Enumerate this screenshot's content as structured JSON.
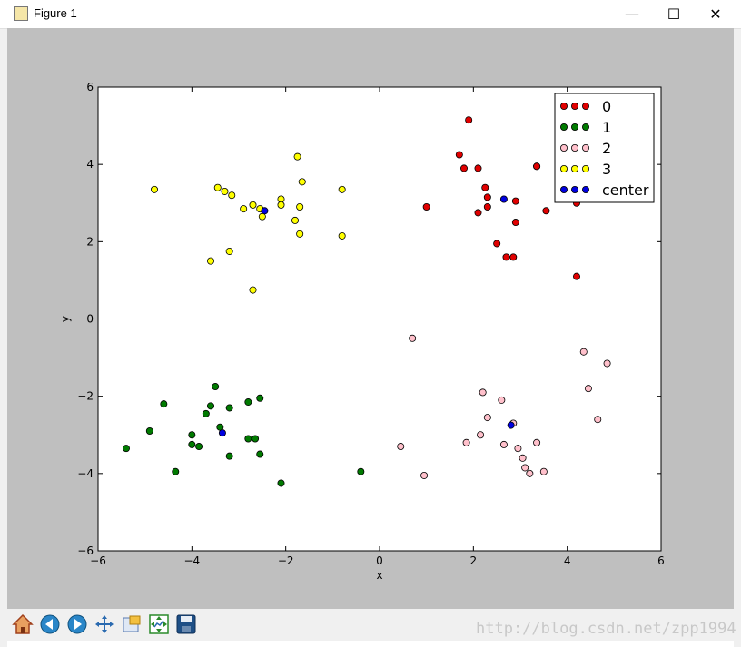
{
  "window": {
    "title": "Figure 1",
    "controls": {
      "minimize": "—",
      "maximize": "☐",
      "close": "✕"
    }
  },
  "toolbar": {
    "tools": [
      {
        "name": "home-icon"
      },
      {
        "name": "back-icon"
      },
      {
        "name": "forward-icon"
      },
      {
        "name": "pan-icon"
      },
      {
        "name": "zoom-icon"
      },
      {
        "name": "subplots-icon"
      },
      {
        "name": "save-icon"
      }
    ]
  },
  "watermark": "http://blog.csdn.net/zpp1994",
  "colors": {
    "c0": "#e00000",
    "c1": "#007a00",
    "c2": "#ffc0cb",
    "c3": "#ffff00",
    "center": "#0000e0",
    "figure_bg": "#bfbfbf"
  },
  "chart_data": {
    "type": "scatter",
    "xlabel": "x",
    "ylabel": "y",
    "xlim": [
      -6,
      6
    ],
    "ylim": [
      -6,
      6
    ],
    "xticks": [
      "−6",
      "−4",
      "−2",
      "0",
      "2",
      "4",
      "6"
    ],
    "yticks": [
      "6",
      "4",
      "2",
      "0",
      "−2",
      "−4",
      "−6"
    ],
    "grid": false,
    "legend_position": "top-right",
    "series": [
      {
        "name": "0",
        "color": "#e00000",
        "x": [
          1.9,
          1.7,
          1.8,
          2.1,
          3.35,
          2.25,
          2.3,
          2.9,
          4.2,
          1.0,
          2.3,
          2.1,
          3.55,
          2.9,
          2.5,
          2.7,
          2.85,
          4.2,
          3.35,
          4.35
        ],
        "y": [
          5.15,
          4.25,
          3.9,
          3.9,
          3.95,
          3.4,
          3.15,
          3.05,
          3.0,
          2.9,
          2.9,
          2.75,
          2.8,
          2.5,
          1.95,
          1.6,
          1.6,
          1.1,
          3.95,
          5.15
        ]
      },
      {
        "name": "1",
        "color": "#007a00",
        "x": [
          -4.6,
          -3.5,
          -3.6,
          -3.7,
          -3.2,
          -2.8,
          -2.55,
          -3.4,
          -4.9,
          -4.0,
          -4.0,
          -3.85,
          -2.8,
          -2.65,
          -5.4,
          -3.2,
          -2.55,
          -4.35,
          -2.1,
          -0.4
        ],
        "y": [
          -2.2,
          -1.75,
          -2.25,
          -2.45,
          -2.3,
          -2.15,
          -2.05,
          -2.8,
          -2.9,
          -3.0,
          -3.25,
          -3.3,
          -3.1,
          -3.1,
          -3.35,
          -3.55,
          -3.5,
          -3.95,
          -4.25,
          -3.95
        ]
      },
      {
        "name": "2",
        "color": "#ffc0cb",
        "x": [
          0.7,
          4.35,
          4.85,
          4.45,
          2.2,
          2.6,
          2.3,
          4.65,
          2.85,
          2.15,
          1.85,
          2.65,
          3.35,
          2.95,
          3.05,
          0.45,
          3.1,
          3.5,
          3.2,
          0.95
        ],
        "y": [
          -0.5,
          -0.85,
          -1.15,
          -1.8,
          -1.9,
          -2.1,
          -2.55,
          -2.6,
          -2.7,
          -3.0,
          -3.2,
          -3.25,
          -3.2,
          -3.35,
          -3.6,
          -3.3,
          -3.85,
          -3.95,
          -4.0,
          -4.05
        ]
      },
      {
        "name": "3",
        "color": "#ffff00",
        "x": [
          -1.75,
          -1.65,
          -4.8,
          -3.45,
          -3.3,
          -3.15,
          -2.1,
          -2.1,
          -2.7,
          -2.55,
          -2.9,
          -1.7,
          -2.5,
          -1.8,
          -1.7,
          -0.8,
          -0.8,
          -3.2,
          -3.6,
          -2.7
        ],
        "y": [
          4.2,
          3.55,
          3.35,
          3.4,
          3.3,
          3.2,
          3.1,
          2.95,
          2.95,
          2.85,
          2.85,
          2.9,
          2.65,
          2.55,
          2.2,
          3.35,
          2.15,
          1.75,
          1.5,
          0.75
        ]
      },
      {
        "name": "center",
        "color": "#0000e0",
        "x": [
          2.65,
          -2.45,
          2.8,
          -3.35
        ],
        "y": [
          3.1,
          2.8,
          -2.75,
          -2.95
        ]
      }
    ]
  }
}
